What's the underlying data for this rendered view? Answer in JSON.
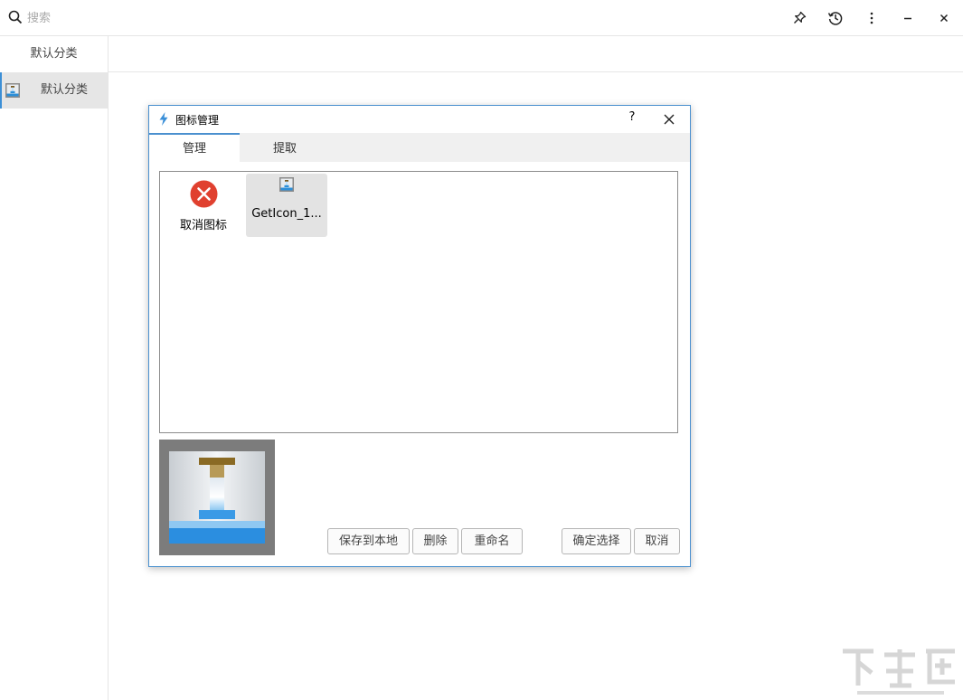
{
  "search": {
    "placeholder": "搜索"
  },
  "toolbar": {
    "pin_icon": "pin-icon",
    "history_icon": "history-icon",
    "more_icon": "more-vertical-icon",
    "minimize_icon": "minimize-icon",
    "close_icon": "close-icon"
  },
  "sidebar": {
    "header": "默认分类",
    "items": [
      {
        "label": "默认分类",
        "icon": "app-icon",
        "selected": true
      }
    ]
  },
  "dialog": {
    "title": "图标管理",
    "help": "?",
    "tabs": [
      {
        "label": "管理",
        "active": true
      },
      {
        "label": "提取",
        "active": false
      }
    ],
    "icons": [
      {
        "label": "取消图标",
        "icon": "cancel-red-icon",
        "selected": false
      },
      {
        "label": "GetIcon_1...",
        "icon": "app-icon",
        "selected": true
      }
    ],
    "buttons": {
      "save_local": "保存到本地",
      "delete": "删除",
      "rename": "重命名",
      "confirm": "确定选择",
      "cancel": "取消"
    }
  },
  "colors": {
    "accent": "#4a90cf",
    "cancel_red": "#e0402f",
    "selected_bg": "#e3e3e3"
  }
}
